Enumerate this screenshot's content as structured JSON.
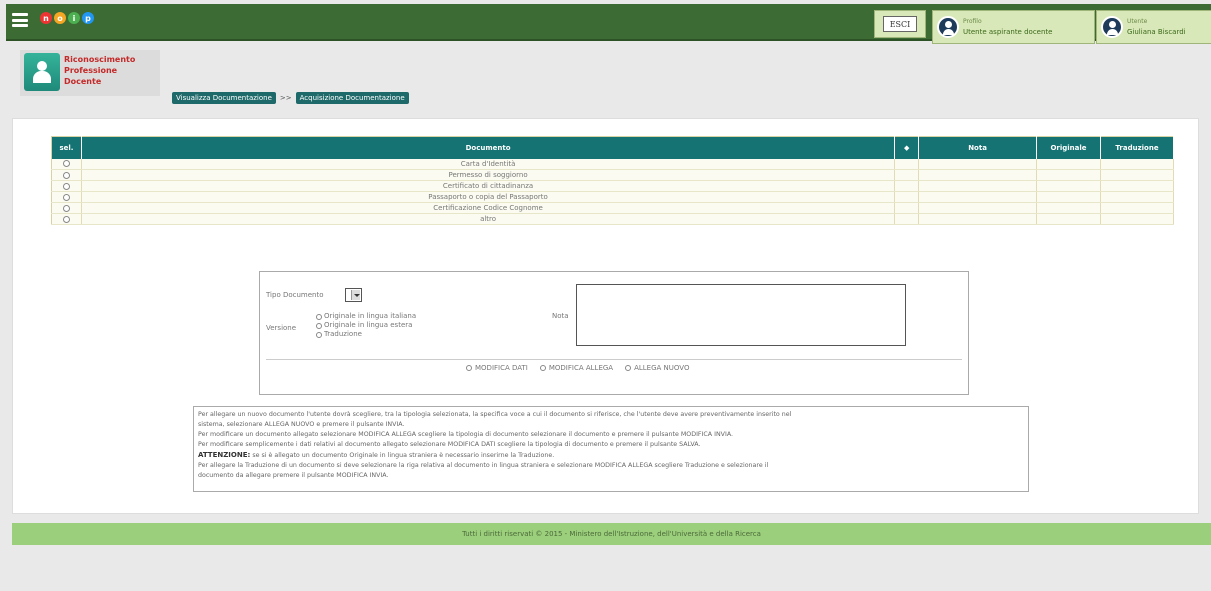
{
  "header": {
    "logo_letters": [
      "n",
      "o",
      "i",
      "p"
    ],
    "logo_colors": [
      "#e33",
      "#f5a623",
      "#4caf50",
      "#2196f3"
    ],
    "esci_label": "ESCI",
    "profilo": {
      "label": "Profilo",
      "value": "Utente aspirante docente"
    },
    "utente": {
      "label": "Utente",
      "value": "Giuliana Biscardi"
    }
  },
  "app": {
    "name_lines": [
      "Riconoscimento",
      "Professione",
      "Docente"
    ]
  },
  "breadcrumb": {
    "items": [
      "Visualizza Documentazione",
      "Acquisizione Documentazione"
    ],
    "separator": ">>"
  },
  "table": {
    "headers": {
      "sel": "sel.",
      "documento": "Documento",
      "flag": "◆",
      "nota": "Nota",
      "originale": "Originale",
      "traduzione": "Traduzione"
    },
    "rows": [
      "Carta d'Identità",
      "Permesso di soggiorno",
      "Certificato di cittadinanza",
      "Passaporto o copia del Passaporto",
      "Certificazione Codice Cognome",
      "altro"
    ]
  },
  "form": {
    "tipo_label": "Tipo Documento",
    "versione_label": "Versione",
    "versione_options": [
      "Originale in lingua italiana",
      "Originale in lingua estera",
      "Traduzione"
    ],
    "nota_label": "Nota",
    "actions": [
      "MODIFICA DATI",
      "MODIFICA ALLEGA",
      "ALLEGA NUOVO"
    ]
  },
  "info": {
    "lines": [
      "Per allegare un nuovo documento l'utente dovrà scegliere, tra la tipologia selezionata, la specifica voce a cui il documento si riferisce, che l'utente deve avere preventivamente inserito nel",
      "sistema, selezionare ALLEGA NUOVO e premere il pulsante INVIA.",
      "Per modificare un documento allegato selezionare MODIFICA ALLEGA scegliere la tipologia di documento selezionare il documento e premere il pulsante MODIFICA INVIA.",
      "Per modificare semplicemente i dati relativi al documento allegato selezionare MODIFICA DATI scegliere la tipologia di documento e premere il pulsante SALVA."
    ],
    "attention_label": "ATTENZIONE:",
    "attention_text": "se si è allegato un documento Originale in lingua straniera è necessario inserirne la Traduzione.",
    "lines_after": [
      "Per allegare la Traduzione di un documento si deve selezionare la riga relativa al documento in lingua straniera e selezionare MODIFICA ALLEGA scegliere Traduzione e selezionare il",
      "documento da allegare premere il pulsante MODIFICA INVIA."
    ]
  },
  "footer": {
    "text": "Tutti i diritti riservati © 2015 - Ministero dell'Istruzione, dell'Università e della Ricerca"
  }
}
